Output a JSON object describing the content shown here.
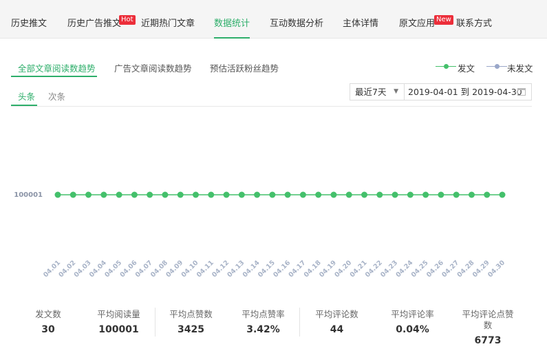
{
  "nav": {
    "tabs": [
      {
        "label": "历史推文"
      },
      {
        "label": "历史广告推文",
        "badge": "Hot"
      },
      {
        "label": "近期热门文章"
      },
      {
        "label": "数据统计",
        "active": true
      },
      {
        "label": "互动数据分析"
      },
      {
        "label": "主体详情"
      },
      {
        "label": "原文应用",
        "badge": "New"
      },
      {
        "label": "联系方式"
      }
    ]
  },
  "subtabs": [
    "全部文章阅读数趋势",
    "广告文章阅读数趋势",
    "预估活跃粉丝趋势"
  ],
  "legend": {
    "posted": "发文",
    "not_posted": "未发文"
  },
  "typetabs": [
    "头条",
    "次条"
  ],
  "controls": {
    "range_select": "最近7天",
    "date_range": "2019-04-01 到 2019-04-30"
  },
  "colors": {
    "accent": "#2dae6a",
    "line": "#44c06b",
    "not_posted": "#9aa7c9",
    "badge": "#ec2e3a"
  },
  "chart_data": {
    "type": "line",
    "categories": [
      "04.01",
      "04.02",
      "04.03",
      "04.04",
      "04.05",
      "04.06",
      "04.07",
      "04.08",
      "04.09",
      "04.10",
      "04.11",
      "04.12",
      "04.13",
      "04.14",
      "04.15",
      "04.16",
      "04.17",
      "04.18",
      "04.19",
      "04.20",
      "04.21",
      "04.22",
      "04.23",
      "04.24",
      "04.25",
      "04.26",
      "04.27",
      "04.28",
      "04.29",
      "04.30"
    ],
    "series": [
      {
        "name": "发文",
        "values": [
          100001,
          100001,
          100001,
          100001,
          100001,
          100001,
          100001,
          100001,
          100001,
          100001,
          100001,
          100001,
          100001,
          100001,
          100001,
          100001,
          100001,
          100001,
          100001,
          100001,
          100001,
          100001,
          100001,
          100001,
          100001,
          100001,
          100001,
          100001,
          100001,
          100001
        ]
      }
    ],
    "yticks": [
      "100001"
    ],
    "grid": false,
    "legend": "top-right"
  },
  "stats": [
    {
      "label": "发文数",
      "value": "30"
    },
    {
      "label": "平均阅读量",
      "value": "100001"
    },
    {
      "label": "平均点赞数",
      "value": "3425"
    },
    {
      "label": "平均点赞率",
      "value": "3.42%"
    },
    {
      "label": "平均评论数",
      "value": "44"
    },
    {
      "label": "平均评论率",
      "value": "0.04%"
    },
    {
      "label_line1": "平均评论点赞",
      "label_line2": "数",
      "value": "6773"
    }
  ]
}
